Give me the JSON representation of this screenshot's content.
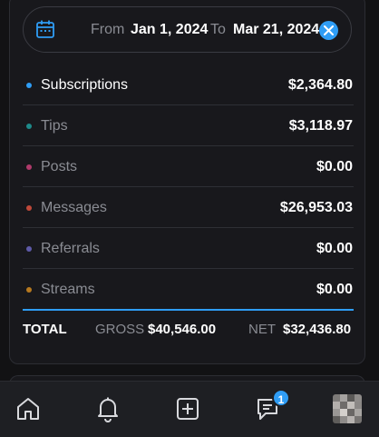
{
  "date_range": {
    "from_label": "From",
    "from_value": "Jan 1, 2024",
    "to_label": "To",
    "to_value": "Mar 21, 2024",
    "icon": "calendar-icon",
    "clear_icon": "close-icon"
  },
  "earnings": [
    {
      "label": "Subscriptions",
      "amount": "$2,364.80",
      "dot_color": "#2f9df5",
      "active": true
    },
    {
      "label": "Tips",
      "amount": "$3,118.97",
      "dot_color": "#1e8a8a",
      "active": false
    },
    {
      "label": "Posts",
      "amount": "$0.00",
      "dot_color": "#b03a6b",
      "active": false
    },
    {
      "label": "Messages",
      "amount": "$26,953.03",
      "dot_color": "#c0493a",
      "active": false
    },
    {
      "label": "Referrals",
      "amount": "$0.00",
      "dot_color": "#5e5aa8",
      "active": false
    },
    {
      "label": "Streams",
      "amount": "$0.00",
      "dot_color": "#b7791f",
      "active": false
    }
  ],
  "total": {
    "label": "TOTAL",
    "gross_label": "GROSS",
    "gross_value": "$40,546.00",
    "net_label": "NET",
    "net_value": "$32,436.80"
  },
  "nav": {
    "items": [
      {
        "name": "home",
        "icon": "home-icon"
      },
      {
        "name": "notifications",
        "icon": "bell-icon"
      },
      {
        "name": "new-post",
        "icon": "plus-square-icon"
      },
      {
        "name": "messages",
        "icon": "message-icon",
        "badge": "1"
      },
      {
        "name": "profile",
        "icon": "avatar"
      }
    ]
  },
  "colors": {
    "accent": "#2f9df5",
    "background": "#121214",
    "card": "#18181c",
    "muted_text": "#8a8c93"
  }
}
